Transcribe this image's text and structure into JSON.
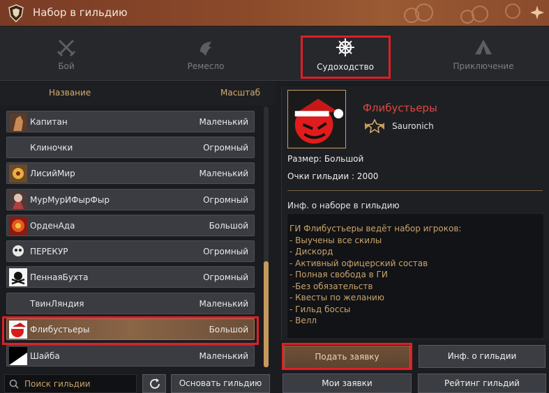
{
  "window": {
    "title": "Набор в гильдию"
  },
  "tabs": [
    {
      "label": "Бой",
      "icon": "crossed-swords-icon"
    },
    {
      "label": "Ремесло",
      "icon": "anvil-hammer-icon"
    },
    {
      "label": "Судоходство",
      "icon": "ship-wheel-icon",
      "active": true
    },
    {
      "label": "Приключение",
      "icon": "tent-icon"
    }
  ],
  "list": {
    "col_name": "Название",
    "col_size": "Масштаб",
    "rows": [
      {
        "name": "Капитан",
        "size": "Маленький"
      },
      {
        "name": "Клиночки",
        "size": "Огромный"
      },
      {
        "name": "ЛисийМир",
        "size": "Маленький"
      },
      {
        "name": "МурМурИФырФыр",
        "size": "Огромный"
      },
      {
        "name": "ОрденАда",
        "size": "Большой"
      },
      {
        "name": "ПЕРЕКУР",
        "size": "Огромный"
      },
      {
        "name": "ПеннаяБухта",
        "size": "Огромный"
      },
      {
        "name": "ТвинЛяндия",
        "size": "Маленький"
      },
      {
        "name": "Флибустьеры",
        "size": "Большой",
        "selected": true
      },
      {
        "name": "Шайба",
        "size": "Маленький"
      }
    ]
  },
  "search": {
    "placeholder": "Поиск гильдии"
  },
  "buttons": {
    "found_guild": "Основать гильдию",
    "apply": "Подать заявку",
    "guild_info": "Инф. о гильдии",
    "my_applications": "Мои заявки",
    "guild_rating": "Рейтинг гильдий"
  },
  "guild": {
    "name": "Флибустьеры",
    "leader": "Sauronich",
    "size_line": "Размер: Большой",
    "points_line": "Очки гильдии : 2000",
    "info_title": "Инф. о наборе в гильдию",
    "info_lines": [
      "ГИ Флибустьеры ведёт набор игроков:",
      "- Выучены все скилы",
      "- Дискорд",
      "- Активный офицерский состав",
      "- Полная свобода в ГИ",
      " -Без обязательств",
      "- Квесты по желанию",
      "- Гильд боссы",
      "- Велл"
    ]
  },
  "colors": {
    "highlight": "#e01f25",
    "accent": "#d6ae6e",
    "guild_name": "#e0473f"
  }
}
